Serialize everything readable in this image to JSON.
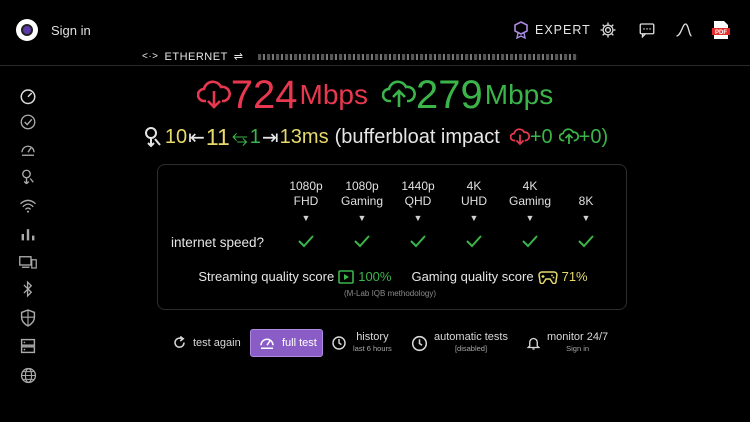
{
  "header": {
    "signin_label": "Sign in",
    "expert_label": "EXPERT",
    "connection_label": "ETHERNET"
  },
  "speeds": {
    "download_value": "724",
    "download_unit": "Mbps",
    "upload_value": "279",
    "upload_unit": "Mbps",
    "download_color": "#e8384f",
    "upload_color": "#3bb54a"
  },
  "latency": {
    "idle": "10",
    "loaded_down": "11",
    "jitter": "1",
    "loaded_up": "13ms",
    "text": "(bufferbloat impact",
    "down_impact": "+0",
    "up_impact": "+0)"
  },
  "quality": {
    "columns": [
      {
        "line1": "1080p",
        "line2": "FHD"
      },
      {
        "line1": "1080p",
        "line2": "Gaming"
      },
      {
        "line1": "1440p",
        "line2": "QHD"
      },
      {
        "line1": "4K",
        "line2": "UHD"
      },
      {
        "line1": "4K",
        "line2": "Gaming"
      },
      {
        "line1": "",
        "line2": "8K"
      }
    ],
    "row_label": "internet speed?",
    "streaming_label": "Streaming quality score",
    "streaming_value": "100%",
    "gaming_label": "Gaming quality score",
    "gaming_value": "71%",
    "methodology": "(M-Lab IQB methodology)"
  },
  "actions": {
    "test_again": "test again",
    "full_test": "full test",
    "history": "history",
    "history_sub": "last 6 hours",
    "automatic": "automatic tests",
    "automatic_sub": "[disabled]",
    "monitor": "monitor 24/7",
    "monitor_sub": "Sign in"
  },
  "sidebar_icons": [
    "speedometer-icon",
    "check-circle-icon",
    "speed-gauge-icon",
    "latency-icon",
    "wifi-icon",
    "bar-chart-icon",
    "devices-icon",
    "bluetooth-icon",
    "shield-icon",
    "server-icon",
    "globe-icon"
  ]
}
